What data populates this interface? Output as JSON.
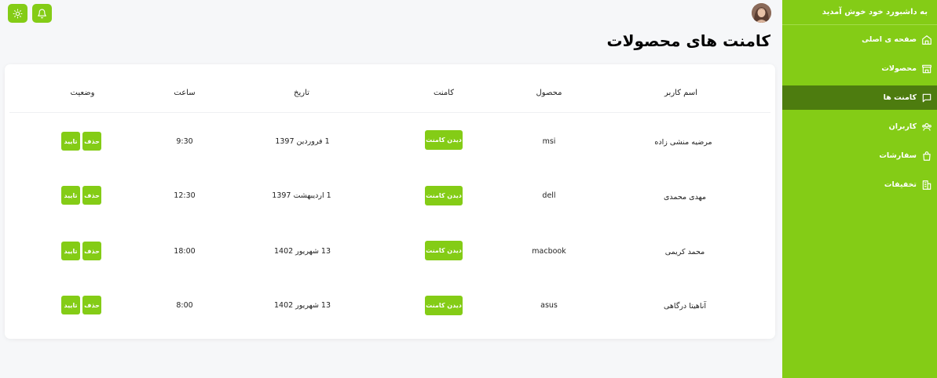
{
  "sidebar": {
    "title": "به داشبورد خود خوش آمدید",
    "items": [
      {
        "label": "صفحه ی اصلی",
        "icon": "home-icon"
      },
      {
        "label": "محصولات",
        "icon": "store-icon"
      },
      {
        "label": "کامنت ها",
        "icon": "comment-icon"
      },
      {
        "label": "کاربران",
        "icon": "users-icon"
      },
      {
        "label": "سفارشات",
        "icon": "shopping-bag-icon"
      },
      {
        "label": "تخفیفات",
        "icon": "discount-building-icon"
      }
    ]
  },
  "header": {
    "title": "کامنت های محصولات"
  },
  "table": {
    "columns": [
      "اسم کاربر",
      "محصول",
      "کامنت",
      "تاریخ",
      "ساعت",
      "وضعیت"
    ],
    "rows": [
      {
        "user": "مرضیه منشی زاده",
        "product": "msi",
        "comment_label": "دیدن کامنت",
        "date": "1 فروردین 1397",
        "time": "9:30",
        "delete_label": "حذف",
        "approve_label": "تایید"
      },
      {
        "user": "مهدی محمدی",
        "product": "dell",
        "comment_label": "دیدن کامنت",
        "date": "1 اردیبهشت 1397",
        "time": "12:30",
        "delete_label": "حذف",
        "approve_label": "تایید"
      },
      {
        "user": "محمد کریمی",
        "product": "macbook",
        "comment_label": "دیدن کامنت",
        "date": "13 شهریور 1402",
        "time": "18:00",
        "delete_label": "حذف",
        "approve_label": "تایید"
      },
      {
        "user": "آناهیتا درگاهی",
        "product": "asus",
        "comment_label": "دیدن کامنت",
        "date": "13 شهریور 1402",
        "time": "8:00",
        "delete_label": "حذف",
        "approve_label": "تایید"
      }
    ]
  },
  "colors": {
    "accent": "#84cc16",
    "active": "#4d7c0f",
    "background": "#f6f7f9"
  }
}
